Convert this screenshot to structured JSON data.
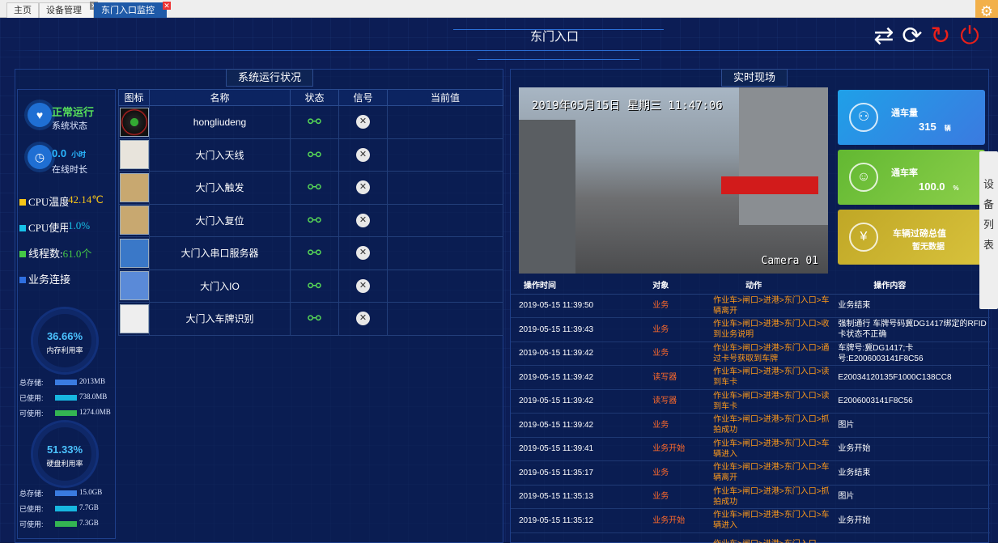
{
  "tabs": [
    {
      "label": "主页"
    },
    {
      "label": "设备管理"
    },
    {
      "label": "东门入口监控"
    }
  ],
  "page_title": "东门入口",
  "controls": {
    "switch_icon": "switch-icon",
    "refresh_icon": "refresh-icon",
    "reload_icon": "reload-icon",
    "power_icon": "power-icon"
  },
  "left_panel": {
    "title": "系统运行状况",
    "status": {
      "value": "正常运行",
      "label": "系统状态"
    },
    "online": {
      "value": "0.0",
      "unit": "小时",
      "label": "在线时长"
    },
    "metrics": [
      {
        "label": "CPU温度:",
        "value": "42.14℃",
        "color": "#f5c518"
      },
      {
        "label": "CPU使用:",
        "value": "1.0%",
        "color": "#17c1e8"
      },
      {
        "label": "线程数:",
        "value": "61.0个",
        "color": "#45c945"
      },
      {
        "label": "业务连接",
        "value": "",
        "color": "#2f6fe0"
      }
    ],
    "memory": {
      "percent": "36.66%",
      "label": "内存利用率",
      "rows": [
        {
          "label": "总存储:",
          "value": "2013MB",
          "color": "#3a7be0"
        },
        {
          "label": "已使用:",
          "value": "738.0MB",
          "color": "#17b7e0"
        },
        {
          "label": "可使用:",
          "value": "1274.0MB",
          "color": "#34b552"
        }
      ]
    },
    "disk": {
      "percent": "51.33%",
      "label": "硬盘利用率",
      "rows": [
        {
          "label": "总存储:",
          "value": "15.0GB",
          "color": "#3a7be0"
        },
        {
          "label": "已使用:",
          "value": "7.7GB",
          "color": "#17b7e0"
        },
        {
          "label": "可使用:",
          "value": "7.3GB",
          "color": "#34b552"
        }
      ]
    },
    "table": {
      "headers": [
        "图标",
        "名称",
        "状态",
        "信号",
        "当前值"
      ],
      "rows": [
        {
          "name": "hongliudeng",
          "thumb": "traffic-light"
        },
        {
          "name": "大门入天线",
          "thumb": "antenna"
        },
        {
          "name": "大门入触发",
          "thumb": "trigger"
        },
        {
          "name": "大门入复位",
          "thumb": "reset"
        },
        {
          "name": "大门入串口服务器",
          "thumb": "serial-server"
        },
        {
          "name": "大门入IO",
          "thumb": "io-module"
        },
        {
          "name": "大门入车牌识别",
          "thumb": "camera"
        }
      ]
    }
  },
  "right_panel": {
    "title": "实时现场",
    "video": {
      "timestamp": "2019年05月15日 星期三 11:47:06",
      "camera": "Camera 01"
    },
    "cards": [
      {
        "title": "通车量",
        "value": "315",
        "unit": "辆",
        "color": "#2f8fe0"
      },
      {
        "title": "通车率",
        "value": "100.0",
        "unit": "%",
        "color": "#6bbf3a"
      },
      {
        "title": "车辆过磅总值",
        "value": "暂无数据",
        "unit": "",
        "color": "#c8b12a"
      }
    ],
    "log": {
      "headers": [
        "操作时间",
        "对象",
        "动作",
        "操作内容"
      ],
      "rows": [
        {
          "time": "2019-05-15 11:39:50",
          "object": "业务",
          "action": "作业车>闸口>进港>东门入口>车辆离开",
          "content": "业务结束"
        },
        {
          "time": "2019-05-15 11:39:43",
          "object": "业务",
          "action": "作业车>闸口>进港>东门入口>收到业务说明",
          "content": "强制通行 车牌号码冀DG1417绑定的RFID卡状态不正确"
        },
        {
          "time": "2019-05-15 11:39:42",
          "object": "业务",
          "action": "作业车>闸口>进港>东门入口>通过卡号获取到车牌",
          "content": "车牌号:冀DG1417;卡号:E2006003141F8C56"
        },
        {
          "time": "2019-05-15 11:39:42",
          "object": "读写器",
          "action": "作业车>闸口>进港>东门入口>读到车卡",
          "content": "E20034120135F1000C138CC8"
        },
        {
          "time": "2019-05-15 11:39:42",
          "object": "读写器",
          "action": "作业车>闸口>进港>东门入口>读到车卡",
          "content": "E2006003141F8C56"
        },
        {
          "time": "2019-05-15 11:39:42",
          "object": "业务",
          "action": "作业车>闸口>进港>东门入口>抓拍成功",
          "content": "图片"
        },
        {
          "time": "2019-05-15 11:39:41",
          "object": "业务开始",
          "action": "作业车>闸口>进港>东门入口>车辆进入",
          "content": "业务开始"
        },
        {
          "time": "2019-05-15 11:35:17",
          "object": "业务",
          "action": "作业车>闸口>进港>东门入口>车辆离开",
          "content": "业务结束"
        },
        {
          "time": "2019-05-15 11:35:13",
          "object": "业务",
          "action": "作业车>闸口>进港>东门入口>抓拍成功",
          "content": "图片"
        },
        {
          "time": "2019-05-15 11:35:12",
          "object": "业务开始",
          "action": "作业车>闸口>进港>东门入口>车辆进入",
          "content": "业务开始"
        },
        {
          "time": "",
          "object": "",
          "action": "作业车>闸口>进港>东门入口",
          "content": ""
        }
      ]
    }
  },
  "side_tab": "设备列表"
}
